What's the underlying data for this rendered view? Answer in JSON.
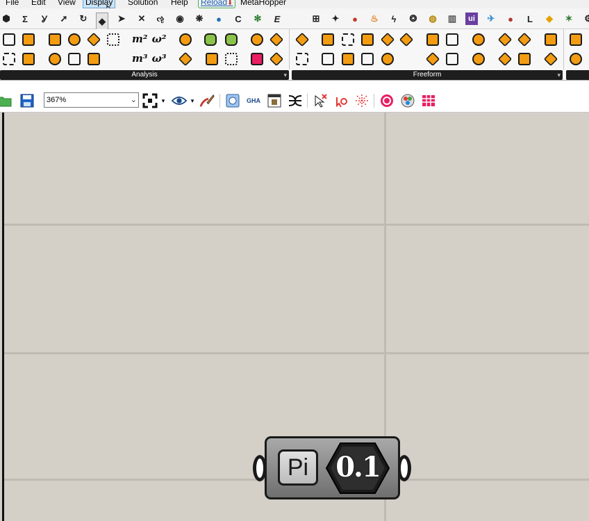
{
  "menu": {
    "file": "File",
    "edit": "Edit",
    "view": "View",
    "display": "Display",
    "solution": "Solution",
    "help": "Help",
    "reload": "Reload",
    "metahopper": "MetaHopper"
  },
  "tab_icons": [
    "hexagon-icon",
    "sigma-icon",
    "sprout-icon",
    "arrow-icon",
    "curve-icon",
    "surface-icon",
    "plane-icon",
    "transform-icon",
    "spiral-icon",
    "eye-icon",
    "sparkle-icon",
    "globe-icon",
    "c-icon",
    "leaf-icon",
    "e-icon",
    "grid-icon",
    "bug-icon",
    "apple-icon",
    "fire-icon",
    "bolt-icon",
    "brain-icon",
    "disk-icon",
    "pillar-icon",
    "ui-icon",
    "bird-icon",
    "ladybug-icon",
    "l-icon",
    "fish-icon",
    "lizard-icon",
    "gear-icon"
  ],
  "ribbon": {
    "groups": [
      {
        "label": "Analysis"
      },
      {
        "label": "Freeform"
      }
    ],
    "analysis_text_icons": [
      "m²",
      "ω²",
      "m³",
      "ω³"
    ]
  },
  "toolbar": {
    "zoom_value": "367%",
    "icons": [
      "open-icon",
      "save-icon",
      "zoom-extents-icon",
      "preview-icon",
      "sketch-icon",
      "bake-icon",
      "gha-icon",
      "canvas-icon",
      "wires-icon",
      "select-icon",
      "selection-filter-icon",
      "cluster-icon",
      "recompute-icon",
      "lights-icon",
      "table-icon"
    ]
  },
  "canvas": {
    "component": {
      "nickname": "Pi",
      "value": "0.1"
    }
  },
  "colors": {
    "accent": "#f39c12",
    "canvas": "#d4d0c8",
    "group_bar": "#1e1e1e"
  }
}
